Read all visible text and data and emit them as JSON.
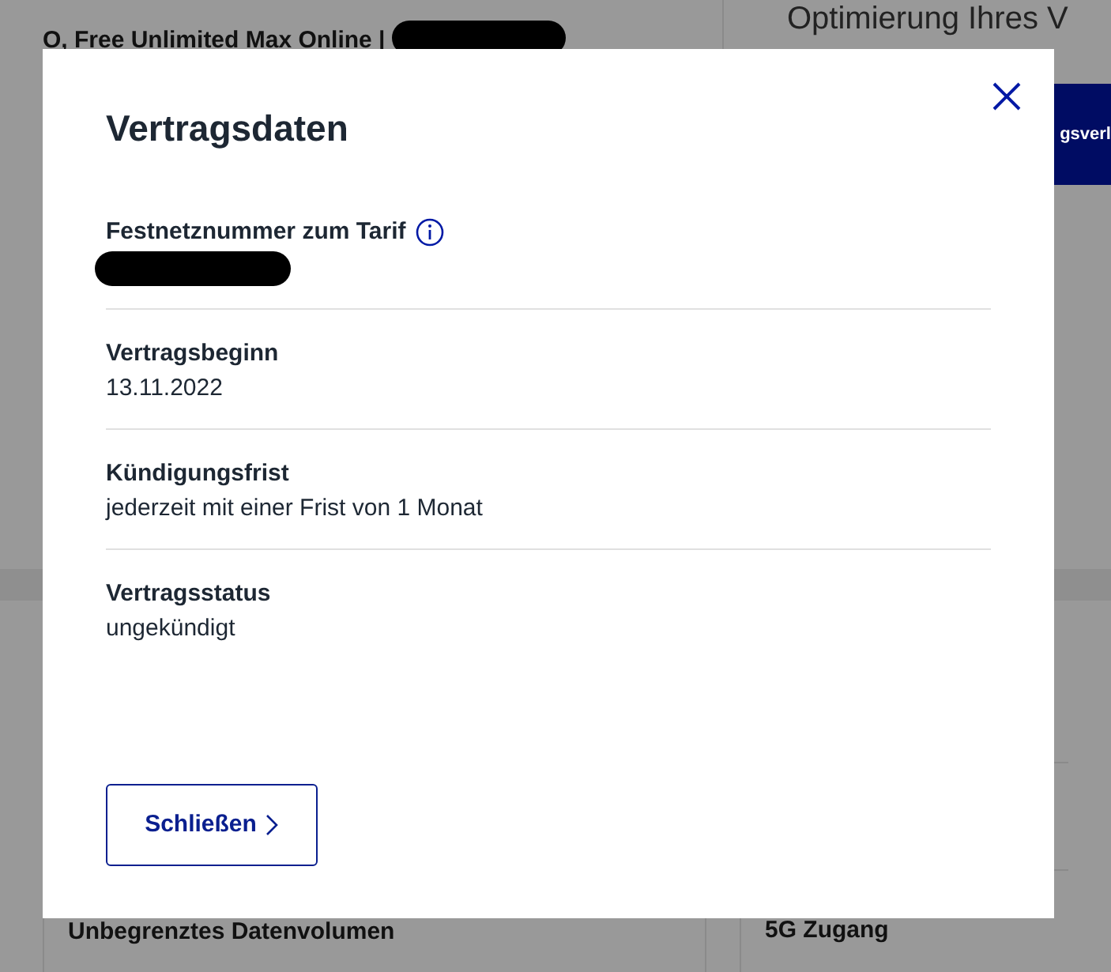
{
  "page": {
    "header": "O, Free Unlimited Max Online |",
    "header_redacted": true,
    "heading": "Optimierung Ihres V",
    "button": "gsverl",
    "features": [
      "Unbegrenztes Datenvolumen",
      "5G Zugang"
    ]
  },
  "dialog": {
    "title": "Vertragsdaten",
    "fields": [
      {
        "label": "Festnetznummer zum Tarif",
        "info": true,
        "redacted": true
      },
      {
        "label": "Vertragsbeginn",
        "info": false,
        "redacted": false,
        "value": "13.11.2022"
      },
      {
        "label": "Kündigungsfrist",
        "info": false,
        "redacted": false,
        "value": "jederzeit mit einer Frist von 1 Monat"
      },
      {
        "label": "Vertragsstatus",
        "info": false,
        "redacted": false,
        "value": "ungekündigt"
      }
    ],
    "close_button": "Schließen"
  }
}
